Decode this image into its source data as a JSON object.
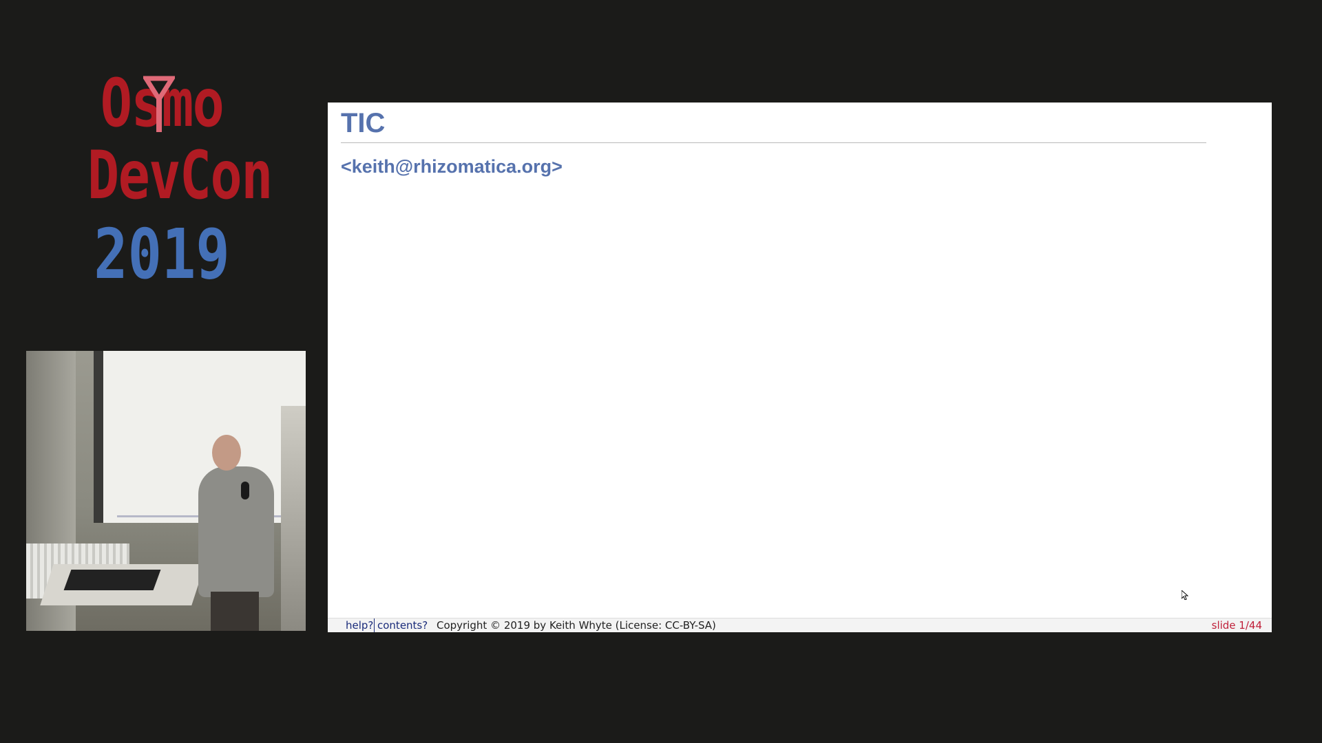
{
  "logo": {
    "line1": "Osmo",
    "line2": "DevCon",
    "line3": "2019",
    "icon": "antenna-icon",
    "colors": {
      "red": "#b11b23",
      "blue": "#4470b7"
    }
  },
  "webcam": {
    "icon": "speaker-video"
  },
  "slide": {
    "title": "TIC",
    "email": "<keith@rhizomatica.org>",
    "title_color": "#5672ad",
    "footer": {
      "help_label": "help?",
      "contents_label": "contents?",
      "copyright": "Copyright © 2019 by Keith Whyte (License: CC-BY-SA)",
      "slide_counter": "slide 1/44",
      "counter_color": "#c0203a"
    }
  }
}
